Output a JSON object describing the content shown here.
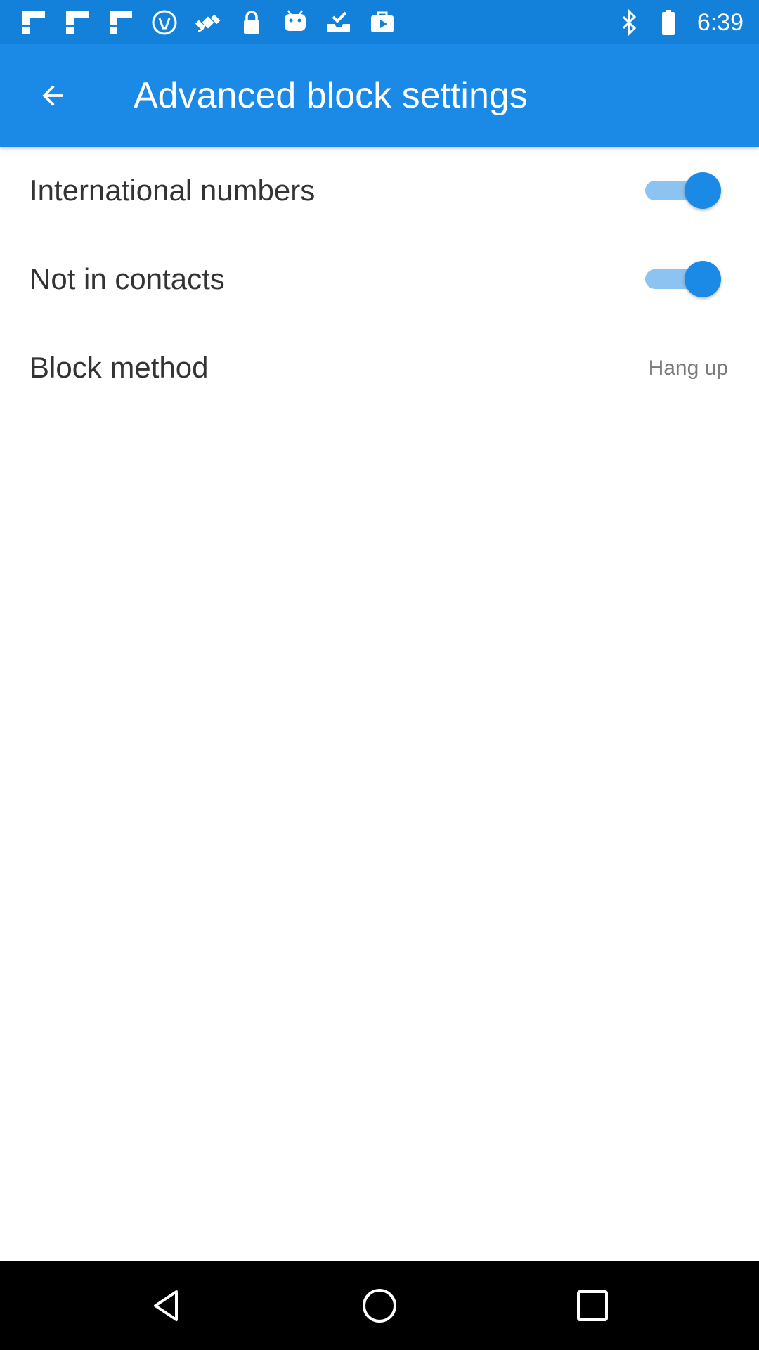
{
  "status_bar": {
    "time": "6:39",
    "left_icons": [
      "flipboard-icon",
      "flipboard-icon",
      "flipboard-icon",
      "wifi-access-icon",
      "fake-gps-icon",
      "lock-icon",
      "android-icon",
      "inbox-check-icon",
      "briefcase-icon"
    ],
    "right_icons": [
      "bluetooth-icon",
      "battery-icon"
    ]
  },
  "app_bar": {
    "title": "Advanced block settings",
    "color": "#1a8ae6"
  },
  "settings": [
    {
      "label": "International numbers",
      "type": "toggle",
      "checked": true
    },
    {
      "label": "Not in contacts",
      "type": "toggle",
      "checked": true
    },
    {
      "label": "Block method",
      "type": "value",
      "value": "Hang up"
    }
  ],
  "nav_bar": {
    "buttons": [
      "back-triangle-icon",
      "home-circle-icon",
      "recents-square-icon"
    ]
  }
}
